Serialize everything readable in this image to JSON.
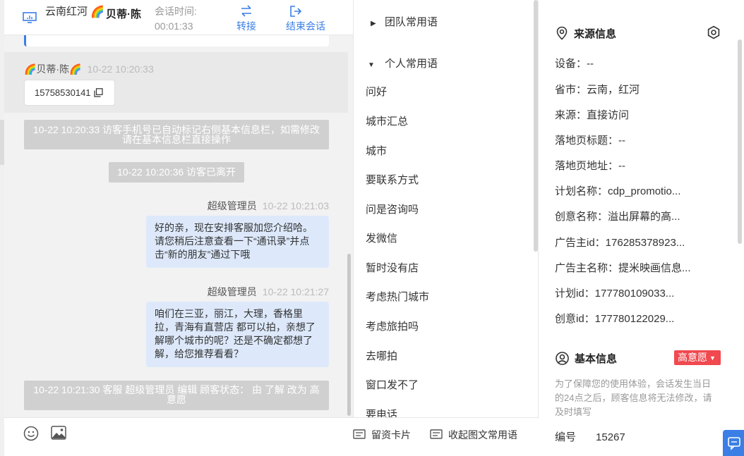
{
  "header": {
    "location": "云南红河",
    "avatar_emoji": "🌈",
    "visitor_name": "贝蒂·陈",
    "session_time_label": "会话时间:",
    "session_time_value": "00:01:33",
    "transfer_label": "转接",
    "end_session_label": "结束会话"
  },
  "messages": {
    "visitor_name": "🌈贝蒂·陈🌈",
    "visitor_time": "10-22 10:20:33",
    "visitor_phone": "15758530141",
    "system_1": "10-22 10:20:33 访客手机号已自动标记右侧基本信息栏，如需修改请在基本信息栏直接操作",
    "system_2": "10-22 10:20:36 访客已离开",
    "agent_1_name": "超级管理员",
    "agent_1_time": "10-22 10:21:03",
    "agent_1_text": "好的亲，现在安排客服加您介绍哈。请您稍后注意查看一下“通讯录”并点击“新的朋友”通过下哦",
    "agent_2_name": "超级管理员",
    "agent_2_time": "10-22 10:21:27",
    "agent_2_text": "咱们在三亚，丽江，大理，香格里拉，青海有直营店 都可以拍，亲想了解哪个城市的呢？还是不确定都想了解，给您推荐看看？",
    "system_3": "10-22 10:21:30 客服 超级管理员 编辑 顾客状态： 由 了解 改为 高意愿"
  },
  "phrases": {
    "team_group": "团队常用语",
    "personal_group": "个人常用语",
    "items": [
      "问好",
      "城市汇总",
      "城市",
      "要联系方式",
      "问是咨询吗",
      "发微信",
      "暂时没有店",
      "考虑热门城市",
      "考虑旅拍吗",
      "去哪拍",
      "窗口发不了",
      "要电话"
    ],
    "footer_card": "留资卡片",
    "footer_collapse": "收起图文常用语"
  },
  "source_info": {
    "title": "来源信息",
    "rows": [
      "设备：--",
      "省市：云南，红河",
      "来源：直接访问",
      "落地页标题：--",
      "落地页地址：--",
      "计划名称：cdp_promotio...",
      "创意名称：溢出屏幕的高...",
      "广告主id：176285378923...",
      "广告主名称：提米映画信息...",
      "计划id：177780109033...",
      "创意id：177780122029..."
    ]
  },
  "basic_info": {
    "title": "基本信息",
    "intent_badge": "高意愿",
    "notice": "为了保障您的使用体验，会话发生当日的24点之后，顾客信息将无法修改，请及时填写",
    "id_label": "编号",
    "id_value": "15267"
  },
  "colors": {
    "accent": "#3a7ee6",
    "agent_bubble": "#dde9fb",
    "system_msg": "#d0d0d0",
    "badge_red": "#f0494f"
  }
}
